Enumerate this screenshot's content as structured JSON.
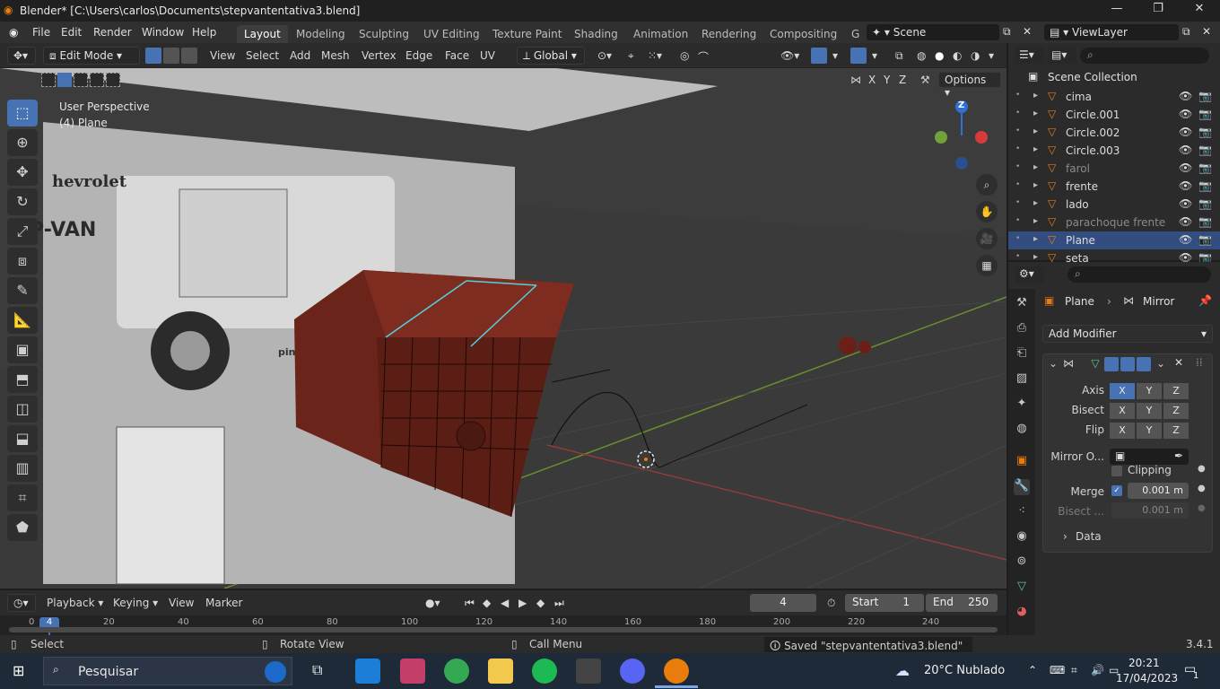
{
  "titlebar": {
    "title": "Blender* [C:\\Users\\carlos\\Documents\\stepvantentativa3.blend]",
    "minimize": "—",
    "maximize": "❐",
    "close": "✕"
  },
  "menubar": {
    "menus": [
      "File",
      "Edit",
      "Render",
      "Window",
      "Help"
    ],
    "workspaces": [
      "Layout",
      "Modeling",
      "Sculpting",
      "UV Editing",
      "Texture Paint",
      "Shading",
      "Animation",
      "Rendering",
      "Compositing",
      "G"
    ],
    "active_workspace": "Layout",
    "scene": "Scene",
    "view_layer": "ViewLayer"
  },
  "header3d": {
    "mode": "Edit Mode",
    "items": [
      "View",
      "Select",
      "Add",
      "Mesh",
      "Vertex",
      "Edge",
      "Face",
      "UV"
    ],
    "transform_orientation": "Global",
    "options": "Options",
    "axis_labels": [
      "X",
      "Y",
      "Z"
    ]
  },
  "viewport": {
    "perspective": "User Perspective",
    "object": "(4) Plane",
    "ref_text_1": "hevrolet",
    "ref_text_2": "EP-VAN",
    "ref_text_3": "pin",
    "gizmo_z": "Z"
  },
  "outliner": {
    "title": "Scene Collection",
    "items": [
      {
        "name": "cima",
        "dim": false,
        "selected": false
      },
      {
        "name": "Circle.001",
        "dim": false,
        "selected": false
      },
      {
        "name": "Circle.002",
        "dim": false,
        "selected": false
      },
      {
        "name": "Circle.003",
        "dim": false,
        "selected": false
      },
      {
        "name": "farol",
        "dim": true,
        "selected": false
      },
      {
        "name": "frente",
        "dim": false,
        "selected": false
      },
      {
        "name": "lado",
        "dim": false,
        "selected": false
      },
      {
        "name": "parachoque frente",
        "dim": true,
        "selected": false
      },
      {
        "name": "Plane",
        "dim": false,
        "selected": true
      },
      {
        "name": "seta",
        "dim": false,
        "selected": false
      }
    ]
  },
  "properties": {
    "breadcrumb_object": "Plane",
    "breadcrumb_modifier": "Mirror",
    "add_modifier": "Add Modifier",
    "axis_label": "Axis",
    "bisect_label": "Bisect",
    "flip_label": "Flip",
    "mirror_object_label": "Mirror O...",
    "clipping_label": "Clipping",
    "merge_label": "Merge",
    "merge_value": "0.001 m",
    "bisect_dist_label": "Bisect ...",
    "bisect_dist_value": "0.001 m",
    "data_label": "Data",
    "x": "X",
    "y": "Y",
    "z": "Z"
  },
  "timeline": {
    "playback": "Playback",
    "keying": "Keying",
    "view": "View",
    "marker": "Marker",
    "current_frame": "4",
    "start_label": "Start",
    "start_value": "1",
    "end_label": "End",
    "end_value": "250",
    "ruler": [
      "0",
      "20",
      "40",
      "60",
      "80",
      "100",
      "120",
      "140",
      "160",
      "180",
      "200",
      "220",
      "240"
    ],
    "playhead": "4"
  },
  "statusbar": {
    "select": "Select",
    "rotate": "Rotate View",
    "call_menu": "Call Menu",
    "message": "Saved \"stepvantentativa3.blend\"",
    "version": "3.4.1"
  },
  "taskbar": {
    "search": "Pesquisar",
    "weather": "20°C  Nublado",
    "time": "20:21",
    "date": "17/04/2023",
    "notifications": "1"
  },
  "colors": {
    "accent": "#4772b3",
    "selected_row": "#334d80",
    "blender_orange": "#e87d0d",
    "mesh_red": "#7a2a1e"
  }
}
